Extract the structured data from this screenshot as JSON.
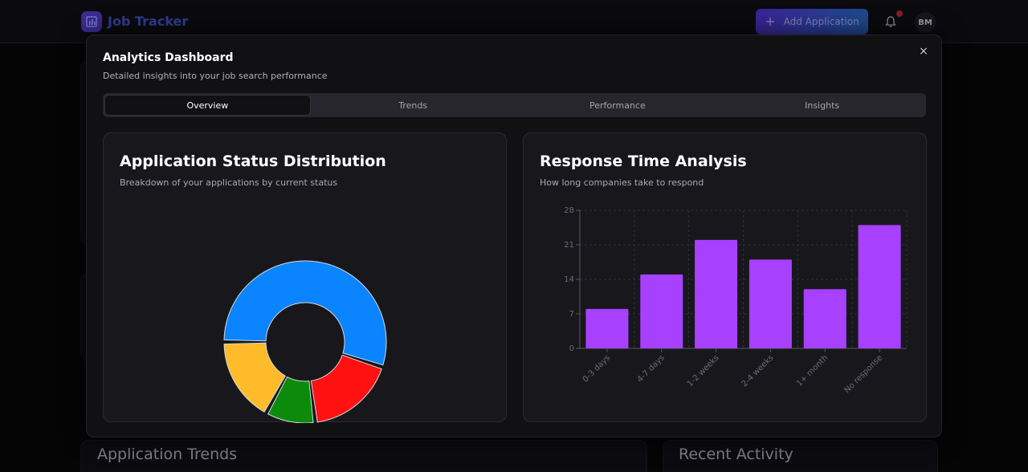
{
  "app": {
    "title": "Job Tracker",
    "add_button": "Add Application",
    "avatar_initials": "BM",
    "accent": "#4b2bd6"
  },
  "background": {
    "trends_title": "Application Trends",
    "activity_title": "Recent Activity"
  },
  "modal": {
    "title": "Analytics Dashboard",
    "description": "Detailed insights into your job search performance",
    "close_label": "×",
    "tabs": [
      {
        "label": "Overview",
        "active": true
      },
      {
        "label": "Trends",
        "active": false
      },
      {
        "label": "Performance",
        "active": false
      },
      {
        "label": "Insights",
        "active": false
      }
    ]
  },
  "status_card": {
    "title": "Application Status Distribution",
    "description": "Breakdown of your applications by current status"
  },
  "response_card": {
    "title": "Response Time Analysis",
    "description": "How long companies take to respond"
  },
  "chart_data": [
    {
      "type": "pie",
      "donut": true,
      "slices": [
        {
          "value": 55,
          "color": "#0a84ff"
        },
        {
          "value": 18,
          "color": "#ff1111"
        },
        {
          "value": 10,
          "color": "#0c8a0c"
        },
        {
          "value": 17,
          "color": "#ffbb2a"
        }
      ]
    },
    {
      "type": "bar",
      "categories": [
        "0-3 days",
        "4-7 days",
        "1-2 weeks",
        "2-4 weeks",
        "1+ month",
        "No response"
      ],
      "values": [
        8,
        15,
        22,
        18,
        12,
        25
      ],
      "ylim": [
        0,
        28
      ],
      "yticks": [
        0,
        7,
        14,
        21,
        28
      ],
      "bar_color": "#a740ff",
      "grid": true
    }
  ]
}
